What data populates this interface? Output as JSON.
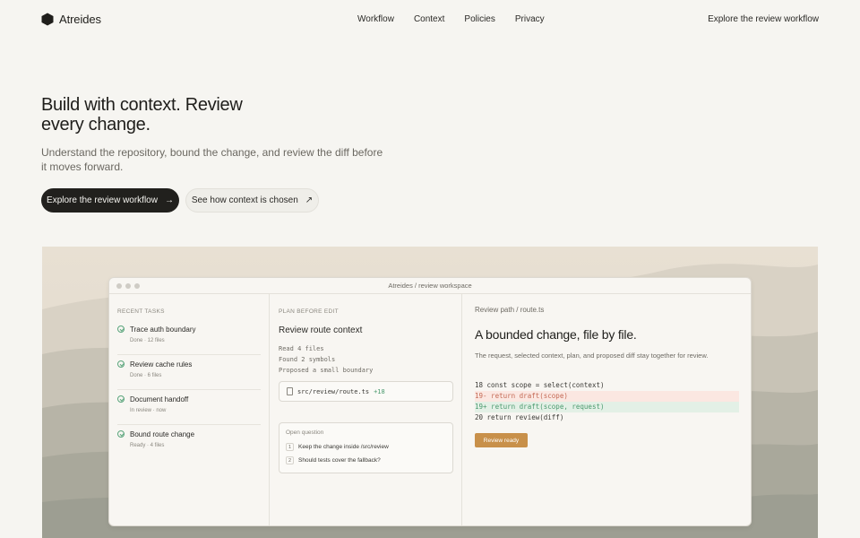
{
  "nav": {
    "brand": "Atreides",
    "links": [
      "Workflow",
      "Context",
      "Policies",
      "Privacy"
    ],
    "cta": "Explore the review workflow"
  },
  "hero": {
    "title": "Build with context. Review every change.",
    "subtitle": "Understand the repository, bound the change, and review the diff before it moves forward.",
    "primary_button": "Explore the review workflow",
    "secondary_button": "See how context is chosen"
  },
  "window": {
    "title": "Atreides / review workspace",
    "tasks_label": "RECENT TASKS",
    "tasks": [
      {
        "title": "Trace auth boundary",
        "meta": "Done · 12 files"
      },
      {
        "title": "Review cache rules",
        "meta": "Done · 6 files"
      },
      {
        "title": "Document handoff",
        "meta": "In review · now"
      },
      {
        "title": "Bound route change",
        "meta": "Ready · 4 files"
      }
    ],
    "plan": {
      "label": "PLAN BEFORE EDIT",
      "title": "Review route context",
      "lines": [
        "Read 4 files",
        "Found 2 symbols",
        "Proposed a small boundary"
      ],
      "file": {
        "name": "src/review/route.ts",
        "added": "+18"
      },
      "question": {
        "label": "Open question",
        "items": [
          {
            "num": "1",
            "text": "Keep the change inside /src/review"
          },
          {
            "num": "2",
            "text": "Should tests cover the fallback?"
          }
        ]
      }
    },
    "review": {
      "path": "Review path / route.ts",
      "title": "A bounded change, file by file.",
      "description": "The request, selected context, plan, and proposed diff stay together for review.",
      "diff": [
        {
          "kind": "context",
          "text": "18 const scope = select(context)"
        },
        {
          "kind": "del",
          "text": "19- return draft(scope)"
        },
        {
          "kind": "add",
          "text": "19+ return draft(scope, request)"
        },
        {
          "kind": "context",
          "text": "20 return review(diff)"
        }
      ],
      "button": "Review ready"
    }
  },
  "colors": {
    "background": "#f6f5f1",
    "primary": "#21201d",
    "accent": "#c8904a",
    "success": "#4b9a6e",
    "danger": "#c46a55"
  }
}
